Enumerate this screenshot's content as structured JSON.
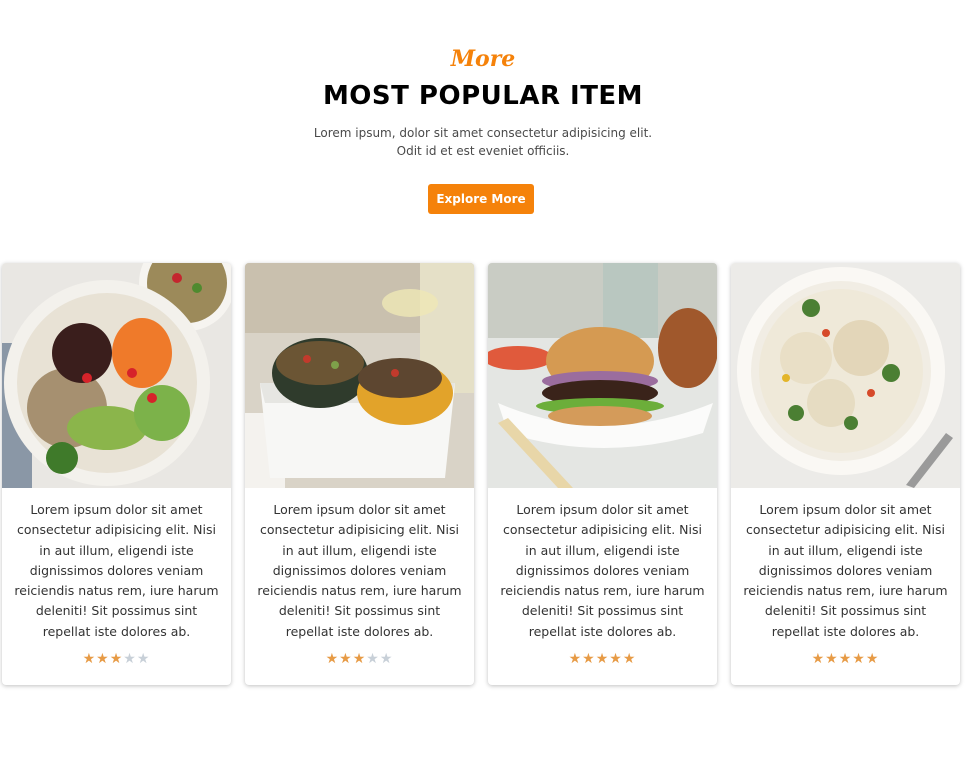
{
  "section": {
    "kicker": "More",
    "title": "MOST POPULAR ITEM",
    "subtitle_line1": "Lorem ipsum, dolor sit amet consectetur adipisicing elit.",
    "subtitle_line2": "Odit id et est eveniet officiis.",
    "button_label": "Explore More"
  },
  "colors": {
    "accent": "#f5820a",
    "star_filled": "#e79b46",
    "star_empty": "#c8d0d8"
  },
  "cards": [
    {
      "image": "buddha-bowl-photo",
      "text": "Lorem ipsum dolor sit amet consectetur adipisicing elit. Nisi in aut illum, eligendi iste dignissimos dolores veniam reiciendis natus rem, iure harum deleniti! Sit possimus sint repellat iste dolores ab.",
      "rating": 3,
      "max_rating": 5
    },
    {
      "image": "stuffed-squash-photo",
      "text": "Lorem ipsum dolor sit amet consectetur adipisicing elit. Nisi in aut illum, eligendi iste dignissimos dolores veniam reiciendis natus rem, iure harum deleniti! Sit possimus sint repellat iste dolores ab.",
      "rating": 3,
      "max_rating": 5
    },
    {
      "image": "burger-photo",
      "text": "Lorem ipsum dolor sit amet consectetur adipisicing elit. Nisi in aut illum, eligendi iste dignissimos dolores veniam reiciendis natus rem, iure harum deleniti! Sit possimus sint repellat iste dolores ab.",
      "rating": 5,
      "max_rating": 5
    },
    {
      "image": "cauliflower-steak-photo",
      "text": "Lorem ipsum dolor sit amet consectetur adipisicing elit. Nisi in aut illum, eligendi iste dignissimos dolores veniam reiciendis natus rem, iure harum deleniti! Sit possimus sint repellat iste dolores ab.",
      "rating": 5,
      "max_rating": 5
    }
  ]
}
